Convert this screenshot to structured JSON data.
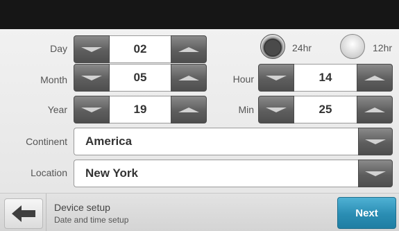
{
  "date": {
    "day_label": "Day",
    "day_value": "02",
    "month_label": "Month",
    "month_value": "05",
    "year_label": "Year",
    "year_value": "19"
  },
  "time": {
    "format_24_label": "24hr",
    "format_12_label": "12hr",
    "selected_format": "24hr",
    "hour_label": "Hour",
    "hour_value": "14",
    "min_label": "Min",
    "min_value": "25"
  },
  "region": {
    "continent_label": "Continent",
    "continent_value": "America",
    "location_label": "Location",
    "location_value": "New York"
  },
  "footer": {
    "title": "Device setup",
    "subtitle": "Date and time setup",
    "next_label": "Next"
  },
  "colors": {
    "accent": "#2a8db3",
    "header": "#161616"
  },
  "icons": {
    "back": "arrow-left-icon",
    "decrement": "triangle-down-icon",
    "increment": "triangle-up-icon",
    "dropdown": "triangle-down-icon"
  }
}
